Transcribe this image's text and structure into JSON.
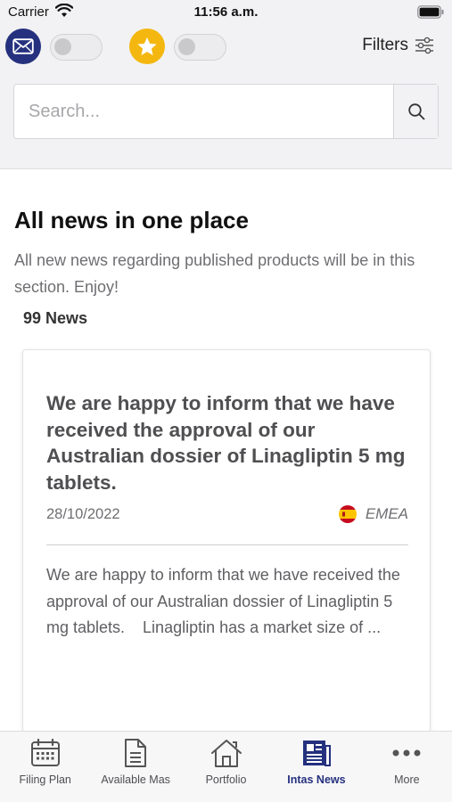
{
  "status_bar": {
    "carrier": "Carrier",
    "time": "11:56 a.m."
  },
  "header": {
    "mail_toggle_on": false,
    "favorites_toggle_on": false,
    "filters_label": "Filters"
  },
  "search": {
    "placeholder": "Search..."
  },
  "main": {
    "title": "All news in one place",
    "subtitle": "All new news regarding published products will be in this section. Enjoy!",
    "news_count": "99 News"
  },
  "news": [
    {
      "title": "We are happy to inform that we have received the approval of our Australian dossier of Linagliptin 5 mg tablets.",
      "date": "28/10/2022",
      "region": "EMEA",
      "region_flag": "spain-flag-icon",
      "body": "We are happy to inform that we have received the approval of our Australian dossier of Linagliptin 5 mg tablets.    Linagliptin has a market size of ..."
    }
  ],
  "tab_bar": {
    "items": [
      {
        "label": "Filing Plan",
        "icon": "calendar-icon"
      },
      {
        "label": "Available Mas",
        "icon": "document-icon"
      },
      {
        "label": "Portfolio",
        "icon": "home-icon"
      },
      {
        "label": "Intas News",
        "icon": "newspaper-icon"
      },
      {
        "label": "More",
        "icon": "more-dots-icon"
      }
    ],
    "active_index": 3
  },
  "colors": {
    "brand_navy": "#25317e",
    "star_yellow": "#f4b70f",
    "panel_gray": "#f2f2f4"
  }
}
